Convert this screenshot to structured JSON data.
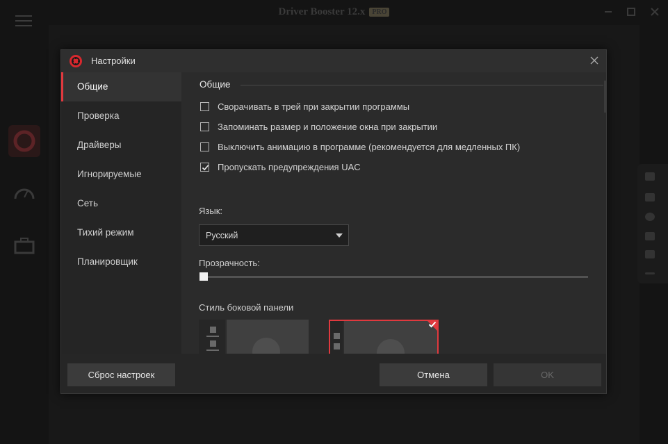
{
  "background_app": {
    "title": "Driver Booster 12.x",
    "badge": "PRO"
  },
  "dialog": {
    "title": "Настройки",
    "nav": [
      {
        "label": "Общие",
        "active": true
      },
      {
        "label": "Проверка",
        "active": false
      },
      {
        "label": "Драйверы",
        "active": false
      },
      {
        "label": "Игнорируемые",
        "active": false
      },
      {
        "label": "Сеть",
        "active": false
      },
      {
        "label": "Тихий режим",
        "active": false
      },
      {
        "label": "Планировщик",
        "active": false
      }
    ],
    "section_title": "Общие",
    "options": [
      {
        "label": "Сворачивать в трей при закрытии программы",
        "checked": false
      },
      {
        "label": "Запоминать размер и положение окна при закрытии",
        "checked": false
      },
      {
        "label": "Выключить анимацию в программе (рекомендуется для медленных ПК)",
        "checked": false
      },
      {
        "label": "Пропускать предупреждения UAC",
        "checked": true
      }
    ],
    "language_label": "Язык:",
    "language_value": "Русский",
    "transparency_label": "Прозрачность:",
    "transparency_value": 0,
    "sidebar_style_label": "Стиль боковой панели",
    "sidebar_style_selected": 2,
    "buttons": {
      "reset": "Сброс настроек",
      "cancel": "Отмена",
      "ok": "OK"
    }
  },
  "colors": {
    "accent": "#e0393e",
    "dialog_bg": "#2b2b2b",
    "nav_bg": "#252525"
  }
}
